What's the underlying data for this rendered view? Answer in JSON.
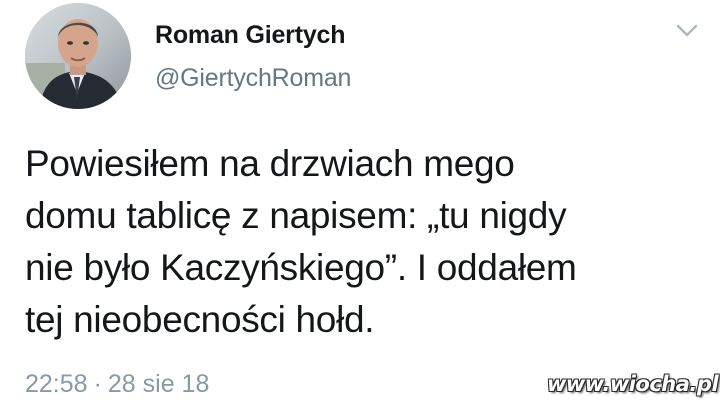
{
  "tweet": {
    "author": {
      "display_name": "Roman Giertych",
      "username": "@GiertychRoman"
    },
    "text": "Powiesiłem na drzwiach mego\ndomu tablicę z napisem: „tu nigdy\nnie było Kaczyńskiego”. I oddałem\ntej nieobecności hołd.",
    "time": "22:58",
    "separator": "·",
    "date": "28 sie 18"
  },
  "watermark": {
    "text": "www.wiocha.pl"
  },
  "icons": {
    "menu": "chevron-down-icon"
  },
  "colors": {
    "text": "#14171a",
    "secondary_text": "#657786",
    "meta_text": "#8899a6",
    "caret": "#aab8c2",
    "background": "#ffffff"
  }
}
